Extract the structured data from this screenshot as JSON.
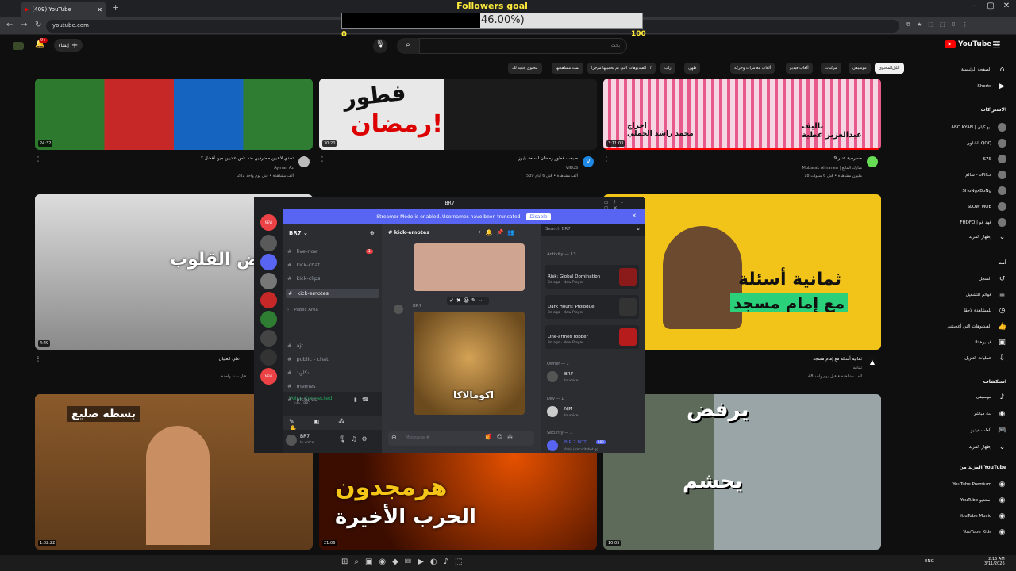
{
  "browser": {
    "tab_title": "(409) YouTube",
    "url": "youtube.com"
  },
  "overlay": {
    "goal_title": "Followers goal",
    "percent_label": "46.00%)",
    "progress": 0.46,
    "min_label": "0",
    "max_label": "100"
  },
  "header": {
    "create_label": "إنشاء",
    "notif_count": "9+",
    "search_placeholder": "بحث",
    "logo_text": "YouTube",
    "logo_region": "SA"
  },
  "chips": [
    "الكل",
    "المحتوى",
    "موسيقى",
    "مركبات",
    "ألعاب فيديو",
    "ألعاب مغامرات وحركة",
    "طهي",
    "راب",
    "كرة القدم",
    "الفيديوهات التي تم تحميلها مؤخرًا",
    "تمت مشاهدتها",
    "محتوى جديد لك"
  ],
  "sidebar": {
    "main": [
      {
        "label": "الصفحة الرئيسية",
        "icon": "home-icon"
      },
      {
        "label": "Shorts",
        "icon": "shorts-icon"
      }
    ],
    "subs_head": "الاشتراكات",
    "subs": [
      "ABO KYAN | ابو كيان",
      "الشاوي QQQ",
      "S7S",
      "سالم - oPiILz",
      "SHoNgxBoNg",
      "SLOW MOE",
      "FHDFO | فهد فو"
    ],
    "show_more": "إظهار المزيد",
    "you_head": "أنت",
    "you": [
      {
        "label": "السجل",
        "icon": "history-icon"
      },
      {
        "label": "قوائم التشغيل",
        "icon": "playlist-icon"
      },
      {
        "label": "للمشاهدة لاحقًا",
        "icon": "clock-icon"
      },
      {
        "label": "الفيديوهات التي أعجبتني",
        "icon": "like-icon"
      },
      {
        "label": "فيديوهاتك",
        "icon": "video-icon"
      },
      {
        "label": "عمليات التنزيل",
        "icon": "download-icon"
      }
    ],
    "explore_head": "استكشاف",
    "explore": [
      {
        "label": "موسيقى",
        "icon": "music-icon"
      },
      {
        "label": "بث مباشر",
        "icon": "live-icon"
      },
      {
        "label": "ألعاب فيديو",
        "icon": "game-icon"
      },
      {
        "label": "إظهار المزيد",
        "icon": "chevron-down-icon"
      }
    ],
    "more_head": "المزيد من YouTube",
    "more": [
      "YouTube Premium",
      "YouTube استديو",
      "YouTube Music",
      "YouTube Kids"
    ]
  },
  "videos": [
    {
      "title": "تحدي لاعبين محترفين ضد ناس عاديين مين أفضل ؟",
      "channel": "Ayman Az",
      "views": "282 ألف مشاهدة • قبل يوم واحد",
      "duration": "24:32"
    },
    {
      "title": "طبخت فطور رمضان لسبعة بايرز",
      "channel": "VIRUS",
      "views": "539 ألف مشاهدة • قبل 6 أيام",
      "duration": "30:20"
    },
    {
      "title": "مسرحية عنبر 9",
      "channel": "Mubarak Almanea | مبارك المانع",
      "views": "18 مليون مشاهدة • قبل 6 سنوات",
      "duration": "3:11:03"
    },
    {
      "title": "علي العليان",
      "channel": "",
      "views": "قبل سنة واحدة",
      "duration": "4:49"
    },
    {
      "title": "ثمانية أسئلة مع إمام مسجد",
      "channel": "ثمانية",
      "views": "48 ألف مشاهدة • قبل يوم واحد",
      "duration": ""
    },
    {
      "title": "",
      "channel": "",
      "views": "",
      "duration": "1:02:22"
    },
    {
      "title": "",
      "channel": "",
      "views": "",
      "duration": "21:06"
    },
    {
      "title": "",
      "channel": "",
      "views": "",
      "duration": "10:05"
    }
  ],
  "discord": {
    "window_title": "BR7",
    "banner_text": "Streamer Mode is enabled. Usernames have been truncated.",
    "banner_button": "Disable",
    "server_name": "BR7",
    "channel_header": "kick-emotes",
    "search_placeholder": "Search BR7",
    "channels": [
      {
        "name": "live-now",
        "badge": "1"
      },
      {
        "name": "kick-chat"
      },
      {
        "name": "kick-clips"
      },
      {
        "name": "kick-emotes",
        "selected": true
      }
    ],
    "category": "Public Area",
    "channels2": [
      "ajr",
      "public - chat",
      "تكاويذ",
      "memes",
      "pictures"
    ],
    "voice_status": "Voice Connected",
    "voice_sub": "live / BR7",
    "user_name": "BR7",
    "user_status": "In voice",
    "author": "BR7",
    "message_placeholder": "Message #",
    "activity_head": "Activity — 13",
    "activities": [
      {
        "title": "Risk: Global Domination",
        "sub": "3d ago · New Player"
      },
      {
        "title": "Dark Hours: Prologue",
        "sub": "3d ago · New Player"
      },
      {
        "title": "One-armed robber",
        "sub": "3d ago · New Player"
      }
    ],
    "owner_head": "Owner — 1",
    "owner": "BR7",
    "owner_status": "In voice",
    "dev_head": "Dev — 1",
    "dev": "NJM",
    "dev_status": "In voice",
    "security_head": "Security — 1",
    "security_bot": "B R 7 BOT",
    "bot_tag": "APP",
    "bot_status": "/help | securitybot.gg",
    "emote_caption": "اكومالاكا"
  },
  "taskbar": {
    "time": "2:15 AM",
    "date": "3/11/2026",
    "lang": "ENG"
  },
  "colors": {
    "accent": "#5865f2",
    "yt_red": "#ff0000",
    "goal_yellow": "#ffeb3b"
  }
}
